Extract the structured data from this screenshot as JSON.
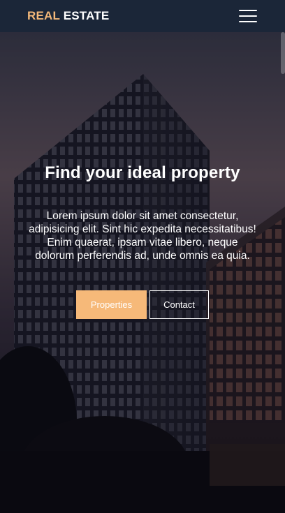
{
  "navbar": {
    "brand_accent": "REAL",
    "brand_rest": " ESTATE",
    "menu_icon": "hamburger-menu-icon"
  },
  "hero": {
    "title": "Find your ideal property",
    "text": "Lorem ipsum dolor sit amet consectetur, adipisicing elit. Sint hic expedita necessitatibus! Enim quaerat, ipsam vitae libero, neque dolorum perferendis ad, unde omnis ea quia.",
    "primary_button": "Properties",
    "secondary_button": "Contact"
  },
  "colors": {
    "navbar_bg": "#1b2638",
    "accent": "#f5b97a",
    "button_primary": "#f6b979",
    "text": "#ffffff"
  }
}
